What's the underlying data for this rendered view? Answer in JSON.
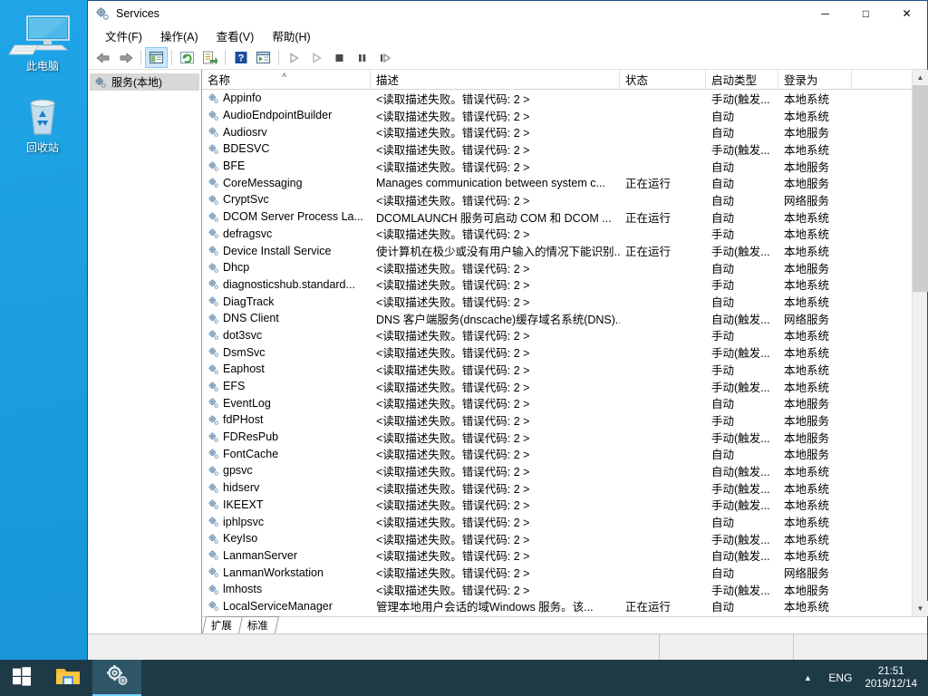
{
  "desktop": {
    "icons": [
      {
        "label": "此电脑",
        "icon": "this-pc-icon"
      },
      {
        "label": "回收站",
        "icon": "recycle-bin-icon"
      }
    ]
  },
  "window": {
    "title": "Services",
    "title_icon": "services-gears-icon",
    "controls": {
      "minimize": "─",
      "maximize": "□",
      "close": "✕"
    },
    "menu": [
      {
        "label": "文件(F)"
      },
      {
        "label": "操作(A)"
      },
      {
        "label": "查看(V)"
      },
      {
        "label": "帮助(H)"
      }
    ],
    "toolbar": [
      {
        "name": "back-icon"
      },
      {
        "name": "forward-icon"
      },
      {
        "name": "show-hide-tree-icon"
      },
      {
        "name": "refresh-icon"
      },
      {
        "name": "export-list-icon"
      },
      {
        "name": "help-icon"
      },
      {
        "name": "properties-icon"
      },
      {
        "name": "start-service-icon"
      },
      {
        "name": "resume-service-icon"
      },
      {
        "name": "stop-service-icon"
      },
      {
        "name": "pause-service-icon"
      },
      {
        "name": "restart-service-icon"
      }
    ],
    "tree": {
      "node_label": "服务(本地)",
      "node_icon": "services-gears-icon"
    },
    "columns": [
      {
        "label": "名称",
        "key": "name"
      },
      {
        "label": "描述",
        "key": "description"
      },
      {
        "label": "状态",
        "key": "status"
      },
      {
        "label": "启动类型",
        "key": "startup"
      },
      {
        "label": "登录为",
        "key": "logon"
      }
    ],
    "sort": {
      "column": "名称",
      "indicator": "˄"
    },
    "rows": [
      {
        "name": "Appinfo",
        "description": "<读取描述失败。错误代码: 2 >",
        "status": "",
        "startup": "手动(触发...",
        "logon": "本地系统"
      },
      {
        "name": "AudioEndpointBuilder",
        "description": "<读取描述失败。错误代码: 2 >",
        "status": "",
        "startup": "自动",
        "logon": "本地系统"
      },
      {
        "name": "Audiosrv",
        "description": "<读取描述失败。错误代码: 2 >",
        "status": "",
        "startup": "自动",
        "logon": "本地服务"
      },
      {
        "name": "BDESVC",
        "description": "<读取描述失败。错误代码: 2 >",
        "status": "",
        "startup": "手动(触发...",
        "logon": "本地系统"
      },
      {
        "name": "BFE",
        "description": "<读取描述失败。错误代码: 2 >",
        "status": "",
        "startup": "自动",
        "logon": "本地服务"
      },
      {
        "name": "CoreMessaging",
        "description": "Manages communication between system c...",
        "status": "正在运行",
        "startup": "自动",
        "logon": "本地服务"
      },
      {
        "name": "CryptSvc",
        "description": "<读取描述失败。错误代码: 2 >",
        "status": "",
        "startup": "自动",
        "logon": "网络服务"
      },
      {
        "name": "DCOM Server Process La...",
        "description": "DCOMLAUNCH 服务可启动 COM 和 DCOM ...",
        "status": "正在运行",
        "startup": "自动",
        "logon": "本地系统"
      },
      {
        "name": "defragsvc",
        "description": "<读取描述失败。错误代码: 2 >",
        "status": "",
        "startup": "手动",
        "logon": "本地系统"
      },
      {
        "name": "Device Install Service",
        "description": "使计算机在极少或没有用户输入的情况下能识别...",
        "status": "正在运行",
        "startup": "手动(触发...",
        "logon": "本地系统"
      },
      {
        "name": "Dhcp",
        "description": "<读取描述失败。错误代码: 2 >",
        "status": "",
        "startup": "自动",
        "logon": "本地服务"
      },
      {
        "name": "diagnosticshub.standard...",
        "description": "<读取描述失败。错误代码: 2 >",
        "status": "",
        "startup": "手动",
        "logon": "本地系统"
      },
      {
        "name": "DiagTrack",
        "description": "<读取描述失败。错误代码: 2 >",
        "status": "",
        "startup": "自动",
        "logon": "本地系统"
      },
      {
        "name": "DNS Client",
        "description": "DNS 客户端服务(dnscache)缓存域名系统(DNS)...",
        "status": "",
        "startup": "自动(触发...",
        "logon": "网络服务"
      },
      {
        "name": "dot3svc",
        "description": "<读取描述失败。错误代码: 2 >",
        "status": "",
        "startup": "手动",
        "logon": "本地系统"
      },
      {
        "name": "DsmSvc",
        "description": "<读取描述失败。错误代码: 2 >",
        "status": "",
        "startup": "手动(触发...",
        "logon": "本地系统"
      },
      {
        "name": "Eaphost",
        "description": "<读取描述失败。错误代码: 2 >",
        "status": "",
        "startup": "手动",
        "logon": "本地系统"
      },
      {
        "name": "EFS",
        "description": "<读取描述失败。错误代码: 2 >",
        "status": "",
        "startup": "手动(触发...",
        "logon": "本地系统"
      },
      {
        "name": "EventLog",
        "description": "<读取描述失败。错误代码: 2 >",
        "status": "",
        "startup": "自动",
        "logon": "本地服务"
      },
      {
        "name": "fdPHost",
        "description": "<读取描述失败。错误代码: 2 >",
        "status": "",
        "startup": "手动",
        "logon": "本地服务"
      },
      {
        "name": "FDResPub",
        "description": "<读取描述失败。错误代码: 2 >",
        "status": "",
        "startup": "手动(触发...",
        "logon": "本地服务"
      },
      {
        "name": "FontCache",
        "description": "<读取描述失败。错误代码: 2 >",
        "status": "",
        "startup": "自动",
        "logon": "本地服务"
      },
      {
        "name": "gpsvc",
        "description": "<读取描述失败。错误代码: 2 >",
        "status": "",
        "startup": "自动(触发...",
        "logon": "本地系统"
      },
      {
        "name": "hidserv",
        "description": "<读取描述失败。错误代码: 2 >",
        "status": "",
        "startup": "手动(触发...",
        "logon": "本地系统"
      },
      {
        "name": "IKEEXT",
        "description": "<读取描述失败。错误代码: 2 >",
        "status": "",
        "startup": "手动(触发...",
        "logon": "本地系统"
      },
      {
        "name": "iphlpsvc",
        "description": "<读取描述失败。错误代码: 2 >",
        "status": "",
        "startup": "自动",
        "logon": "本地系统"
      },
      {
        "name": "KeyIso",
        "description": "<读取描述失败。错误代码: 2 >",
        "status": "",
        "startup": "手动(触发...",
        "logon": "本地系统"
      },
      {
        "name": "LanmanServer",
        "description": "<读取描述失败。错误代码: 2 >",
        "status": "",
        "startup": "自动(触发...",
        "logon": "本地系统"
      },
      {
        "name": "LanmanWorkstation",
        "description": "<读取描述失败。错误代码: 2 >",
        "status": "",
        "startup": "自动",
        "logon": "网络服务"
      },
      {
        "name": "lmhosts",
        "description": "<读取描述失败。错误代码: 2 >",
        "status": "",
        "startup": "手动(触发...",
        "logon": "本地服务"
      },
      {
        "name": "LocalServiceManager",
        "description": "管理本地用户会话的域Windows 服务。该...",
        "status": "正在运行",
        "startup": "自动",
        "logon": "本地系统"
      }
    ],
    "tabs": [
      {
        "label": "扩展",
        "active": false
      },
      {
        "label": "标准",
        "active": true
      }
    ]
  },
  "taskbar": {
    "start": {
      "icon": "windows-logo-icon"
    },
    "buttons": [
      {
        "icon": "file-explorer-icon",
        "running": false
      },
      {
        "icon": "services-gears-icon",
        "running": true
      }
    ],
    "tray": {
      "chevron": "▲",
      "language": "ENG",
      "time": "21:51",
      "date": "2019/12/14"
    }
  },
  "colors": {
    "desktop": "#1b9ede",
    "taskbar": "#1f3a47",
    "accent": "#0078d7",
    "window_border": "#1b4f8a"
  }
}
